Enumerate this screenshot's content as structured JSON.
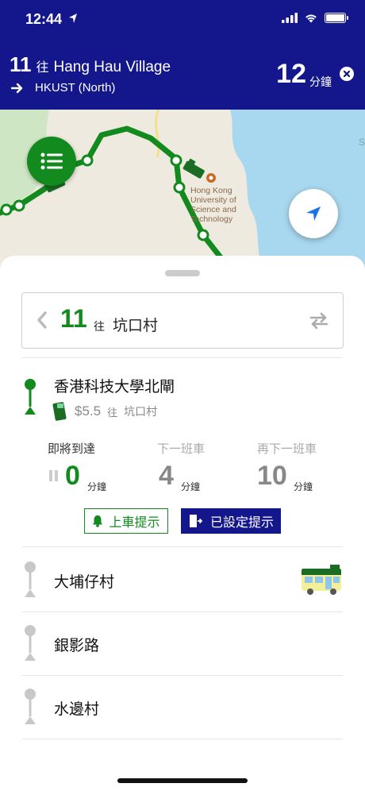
{
  "statusbar": {
    "time": "12:44"
  },
  "header": {
    "route_number": "11",
    "to_label": "往",
    "destination": "Hang Hau Village",
    "next_stop": "HKUST (North)",
    "eta_minutes": "12",
    "eta_unit": "分鐘"
  },
  "map": {
    "label_lines": [
      "Hong Kong",
      "University of",
      "Science and",
      "Technology"
    ],
    "edge_letter": "S"
  },
  "route_selector": {
    "route_number": "11",
    "to_label": "往",
    "destination": "坑口村"
  },
  "current_stop": {
    "name": "香港科技大學北閘",
    "fare": "$5.5",
    "to_label": "往",
    "fare_destination": "坑口村"
  },
  "etas": [
    {
      "label": "即將到達",
      "value": "0",
      "unit": "分鐘"
    },
    {
      "label": "下一班車",
      "value": "4",
      "unit": "分鐘"
    },
    {
      "label": "再下一班車",
      "value": "10",
      "unit": "分鐘"
    }
  ],
  "buttons": {
    "board_alert": "上車提示",
    "alert_set": "已設定提示"
  },
  "stops": [
    {
      "name": "大埔仔村"
    },
    {
      "name": "銀影路"
    },
    {
      "name": "水邊村"
    }
  ],
  "colors": {
    "header_bg": "#14168c",
    "route_green": "#128a1e",
    "water": "#a8d8ef"
  }
}
